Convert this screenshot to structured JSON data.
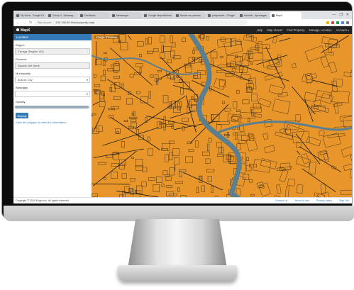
{
  "browser": {
    "tabs": [
      {
        "label": "My Drive - Google Dr"
      },
      {
        "label": "Group 4 - Almanaq"
      },
      {
        "label": "Facebook"
      },
      {
        "label": "Messenger"
      },
      {
        "label": "Google Maps/Butuan"
      },
      {
        "label": "Border for pictures"
      },
      {
        "label": "peeperexin - Google"
      },
      {
        "label": "tutorials - Aprenagen"
      },
      {
        "label": "MapX",
        "active": true
      }
    ],
    "address": {
      "security": "Not secure",
      "url": "192.168.50.6/mk/property-map"
    },
    "window_controls": [
      "—",
      "❐",
      "✕"
    ]
  },
  "app": {
    "brand": "MapX",
    "nav": [
      "Help",
      "Map Viewer",
      "Find Property",
      "Manage Location",
      "Account ▾"
    ]
  },
  "sidebar": {
    "header": "Location",
    "region_label": "Region",
    "region_value": "Caraga (Region XIII)",
    "province_label": "Province",
    "province_value": "Agusan del Norte",
    "municipality_label": "Municipality",
    "municipality_value": "Butuan City",
    "barangay_label": "Barangay",
    "barangay_value": "",
    "opacity_label": "Opacity",
    "opacity_level": 0.98,
    "display_button": "Display",
    "hint": "Click the polygon to view the information."
  },
  "map": {
    "title": "Image Preview",
    "fill_color": "#e8952a",
    "line_color": "#1a1a1a",
    "river_color": "#5b7f8f"
  },
  "footer": {
    "copyright": "Copyright © 2019 Engin Inc. All rights reserved.",
    "links": [
      "Contact Us",
      "Terms of use",
      "Privacy policy",
      "Sign Out"
    ]
  }
}
